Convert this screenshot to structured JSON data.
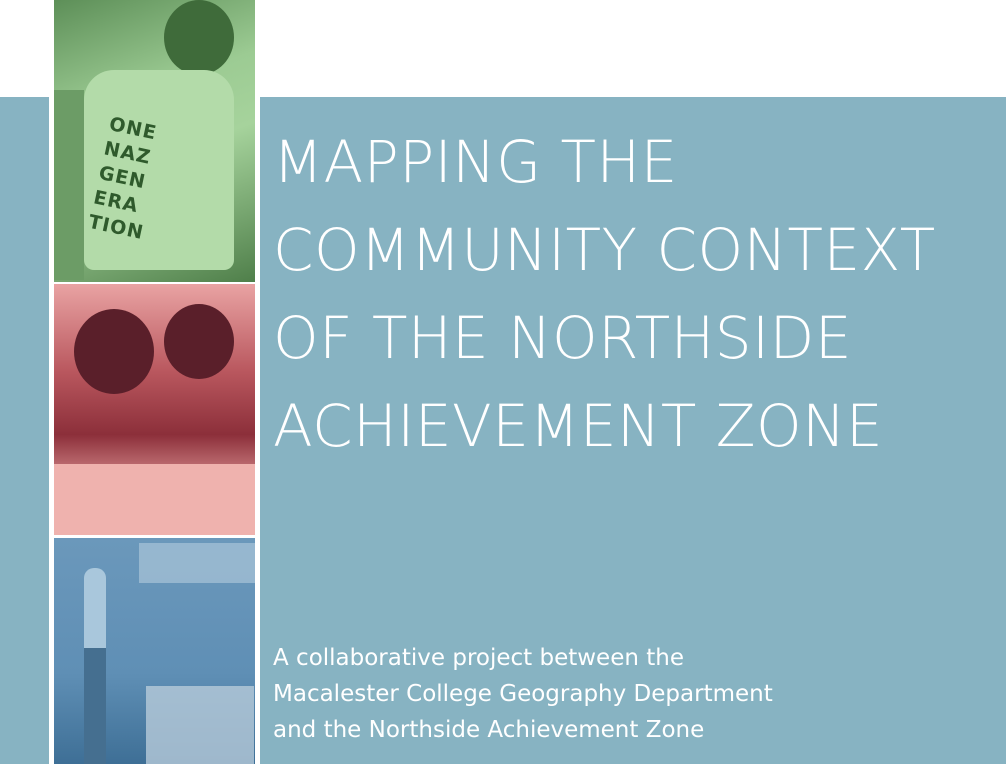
{
  "cover": {
    "title_lines": [
      "MAPPING THE",
      "COMMUNITY CONTEXT",
      "OF THE NORTHSIDE",
      "ACHIEVEMENT ZONE"
    ],
    "subtitle_lines": [
      "A collaborative project between the",
      "Macalester College Geography Department",
      "and the Northside Achievement Zone"
    ]
  },
  "colors": {
    "background_band": "#87b3c2",
    "photo_tint_top": "#9ccb93",
    "photo_tint_middle": "#e9a3a3",
    "photo_tint_bottom": "#6b98bb",
    "text": "#ffffff"
  },
  "photos": [
    {
      "tint": "green",
      "shirt_text": "ONE NAZ GEN ERA TION"
    },
    {
      "tint": "pink"
    },
    {
      "tint": "blue"
    }
  ]
}
